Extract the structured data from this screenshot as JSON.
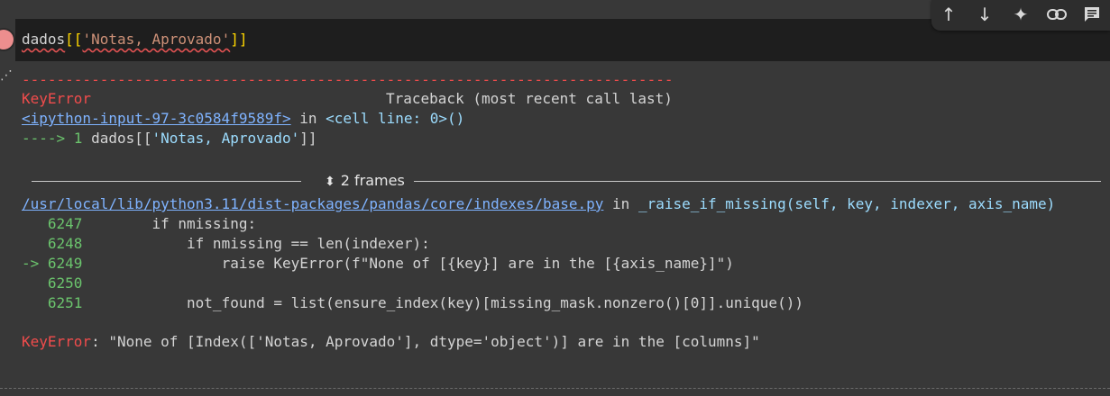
{
  "cell": {
    "code_name": "dados",
    "code_open": "[[",
    "code_string": "'Notas, Aprovado'",
    "code_close": "]]"
  },
  "toolbar": {
    "icons": [
      {
        "name": "arrow-up-icon",
        "glyph": "↑"
      },
      {
        "name": "arrow-down-icon",
        "glyph": "↓"
      },
      {
        "name": "sparkle-icon",
        "glyph": "✦"
      },
      {
        "name": "link-icon",
        "glyph": "🔗"
      },
      {
        "name": "comment-icon",
        "glyph": "▤"
      }
    ]
  },
  "output": {
    "dash_rule": "---------------------------------------------------------------------------",
    "error_type": "KeyError",
    "traceback_header": "Traceback (most recent call last)",
    "frame1_file": "<ipython-input-97-3c0584f9589f>",
    "frame1_in": " in ",
    "frame1_func": "<cell line: 0>()",
    "frame1_arrow": "----> 1 ",
    "frame1_code_a": "dados[[",
    "frame1_code_str": "'Notas, Aprovado'",
    "frame1_code_b": "]]",
    "frames_label": "2 frames",
    "frame2_file": "/usr/local/lib/python3.11/dist-packages/pandas/core/indexes/base.py",
    "frame2_in": " in ",
    "frame2_func": "_raise_if_missing(self, key, indexer, axis_name)",
    "lines": [
      {
        "marker": "   ",
        "num": "6247",
        "code": "        if nmissing:"
      },
      {
        "marker": "   ",
        "num": "6248",
        "code": "            if nmissing == len(indexer):"
      },
      {
        "marker": "-> ",
        "num": "6249",
        "code": "                raise KeyError(f\"None of [{key}] are in the [{axis_name}]\")"
      },
      {
        "marker": "   ",
        "num": "6250",
        "code": ""
      },
      {
        "marker": "   ",
        "num": "6251",
        "code": "            not_found = list(ensure_index(key)[missing_mask.nonzero()[0]].unique())"
      }
    ],
    "final_error_type": "KeyError",
    "final_error_msg": ": \"None of [Index(['Notas, Aprovado'], dtype='object')] are in the [columns]\""
  },
  "colors": {
    "background": "#383838",
    "input_bg": "#1e1e1e",
    "error_red": "#f14c4c",
    "line_number_green": "#6bc46d",
    "link_blue": "#7fb3ff"
  }
}
